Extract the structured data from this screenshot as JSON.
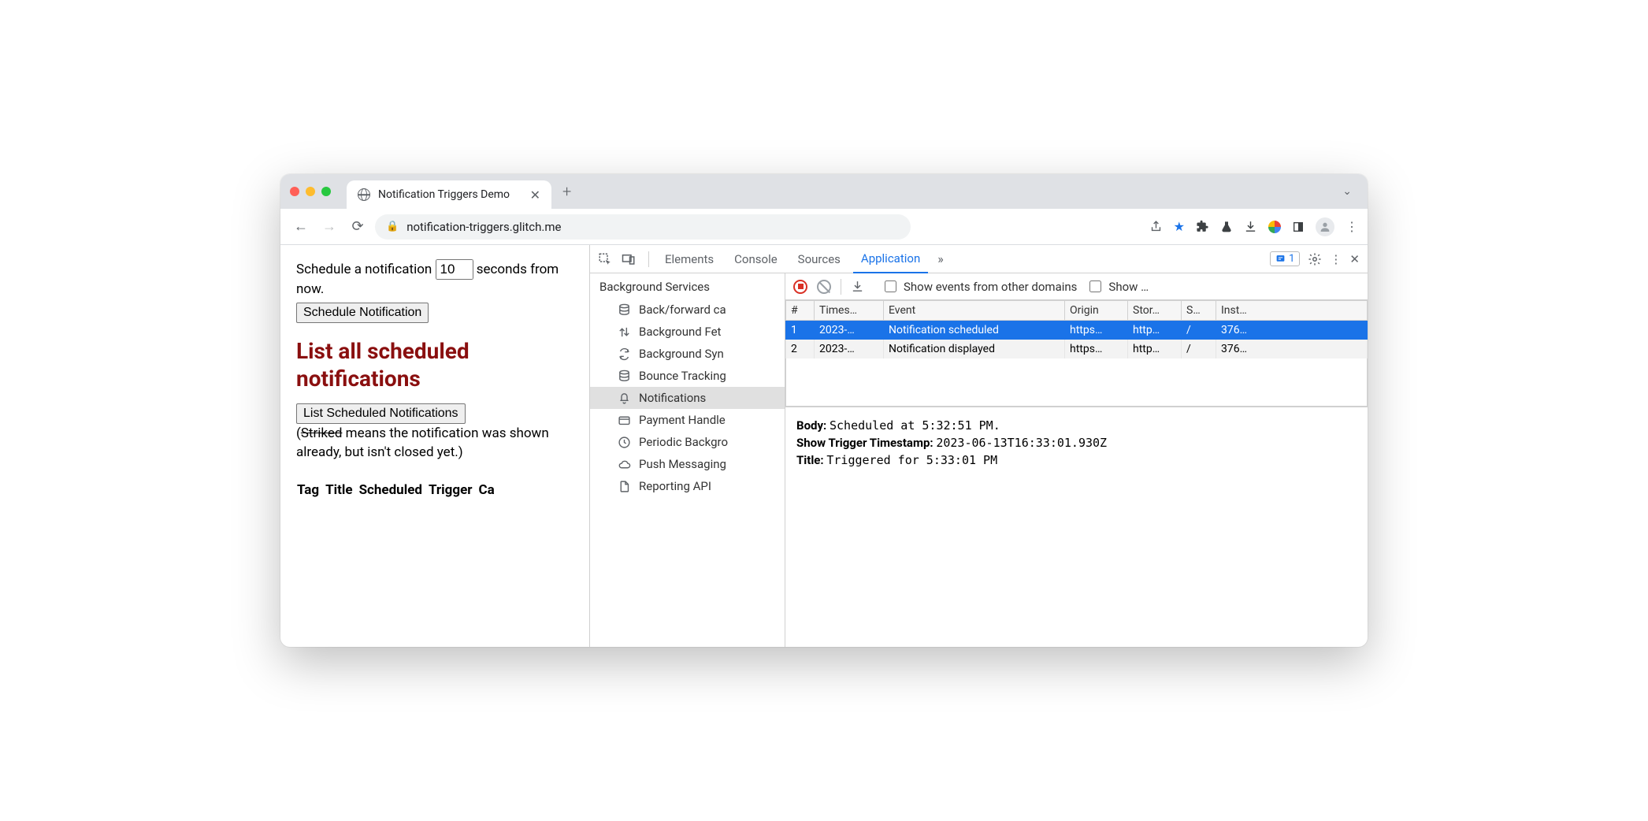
{
  "window": {
    "tab_title": "Notification Triggers Demo",
    "url": "notification-triggers.glitch.me"
  },
  "page": {
    "schedule_pre": "Schedule a notification",
    "schedule_value": "10",
    "schedule_post": "seconds from now.",
    "schedule_button": "Schedule Notification",
    "heading": "List all scheduled notifications",
    "list_button": "List Scheduled Notifications",
    "note_open": "(",
    "note_strike": "Striked",
    "note_rest": " means the notification was shown already, but isn't closed yet.)",
    "table_headers": [
      "Tag",
      "Title",
      "Scheduled",
      "Trigger",
      "Ca"
    ]
  },
  "devtools": {
    "tabs": [
      "Elements",
      "Console",
      "Sources",
      "Application"
    ],
    "active_tab": "Application",
    "issues_count": "1",
    "sidebar": {
      "heading": "Background Services",
      "items": [
        {
          "icon": "db",
          "label": "Back/forward ca"
        },
        {
          "icon": "updown",
          "label": "Background Fet"
        },
        {
          "icon": "sync",
          "label": "Background Syn"
        },
        {
          "icon": "db",
          "label": "Bounce Tracking"
        },
        {
          "icon": "bell",
          "label": "Notifications",
          "selected": true
        },
        {
          "icon": "card",
          "label": "Payment Handle"
        },
        {
          "icon": "clock",
          "label": "Periodic Backgro"
        },
        {
          "icon": "cloud",
          "label": "Push Messaging"
        },
        {
          "icon": "doc",
          "label": "Reporting API"
        }
      ]
    },
    "toolbar": {
      "show_other": "Show events from other domains",
      "show_trunc": "Show …"
    },
    "table": {
      "columns": [
        "#",
        "Times…",
        "Event",
        "Origin",
        "Stor…",
        "S…",
        "Inst…"
      ],
      "colwidths": [
        "36px",
        "88px",
        "230px",
        "80px",
        "68px",
        "44px",
        "auto"
      ],
      "rows": [
        {
          "n": "1",
          "ts": "2023-…",
          "event": "Notification scheduled",
          "origin": "https…",
          "stor": "http…",
          "s": "/",
          "inst": "376…",
          "selected": true
        },
        {
          "n": "2",
          "ts": "2023-…",
          "event": "Notification displayed",
          "origin": "https…",
          "stor": "http…",
          "s": "/",
          "inst": "376…"
        }
      ]
    },
    "details": {
      "body_k": "Body:",
      "body_v": "Scheduled at 5:32:51 PM.",
      "stt_k": "Show Trigger Timestamp:",
      "stt_v": "2023-06-13T16:33:01.930Z",
      "title_k": "Title:",
      "title_v": "Triggered for 5:33:01 PM"
    }
  }
}
